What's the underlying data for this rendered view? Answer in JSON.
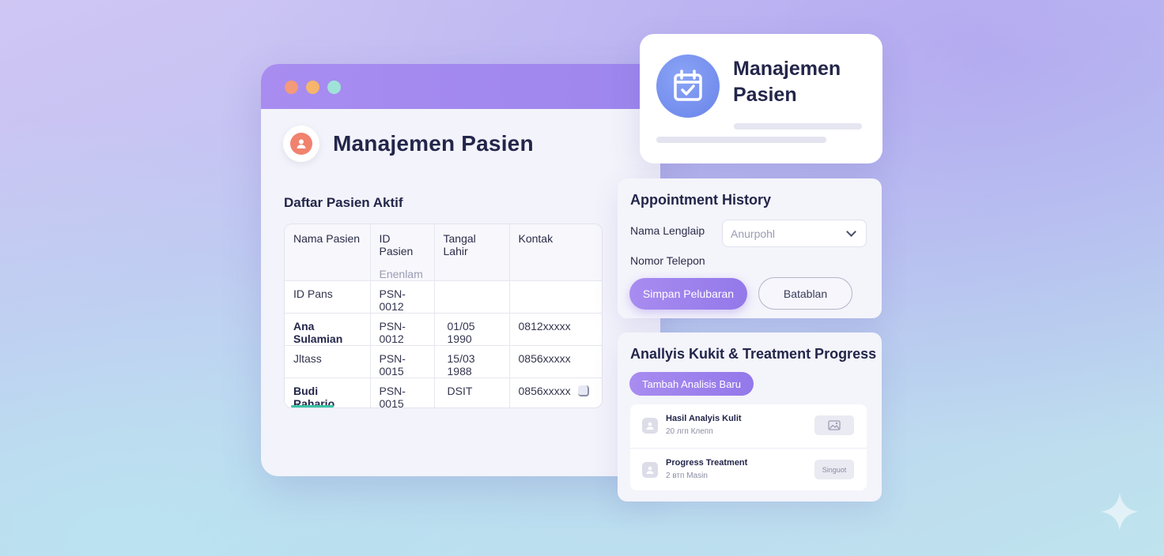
{
  "main_window": {
    "app_title": "Manajemen Pasien",
    "section_title": "Daftar Pasien Aktif",
    "table": {
      "headers": [
        "Nama Pasien",
        "ID Pasien",
        "Tangal Lahir",
        "Kontak"
      ],
      "header_sub": "Enenlam",
      "rows": [
        [
          "ID Pans",
          "PSN-0012",
          "",
          ""
        ],
        [
          "Ana Sulamian",
          "PSN-0012",
          "01/05 1990",
          "0812xxxxx"
        ],
        [
          "Jltass",
          "PSN-0015",
          "15/03 1988",
          "0856xxxxx"
        ],
        [
          "Budi Raharjo",
          "PSN-0015",
          "DSIT",
          "0856xxxxx"
        ]
      ]
    }
  },
  "card_top": {
    "title_line1": "Manajemen",
    "title_line2": "Pasien",
    "icon": "calendar-check-icon"
  },
  "appointment": {
    "heading": "Appointment History",
    "name_label": "Nama Lenglaip",
    "name_value": "Anurpohl",
    "phone_label": "Nomor Telepon",
    "save_label": "Simpan Pelubaran",
    "cancel_label": "Batablan"
  },
  "analysis": {
    "heading": "Anallyis Kukit & Treatment Progress",
    "add_label": "Tambah Analisis Baru",
    "items": [
      {
        "title": "Hasil Analyis Kulit",
        "sub": "20 лгп Клепп",
        "thumb": ""
      },
      {
        "title": "Progress Treatment",
        "sub": "2 втп Masin",
        "thumb": "Singuot"
      }
    ]
  },
  "colors": {
    "accent": "#a88cf0",
    "progress": "#3cc4a6",
    "avatar": "#f0826e",
    "calendar": "#6a84ea"
  }
}
